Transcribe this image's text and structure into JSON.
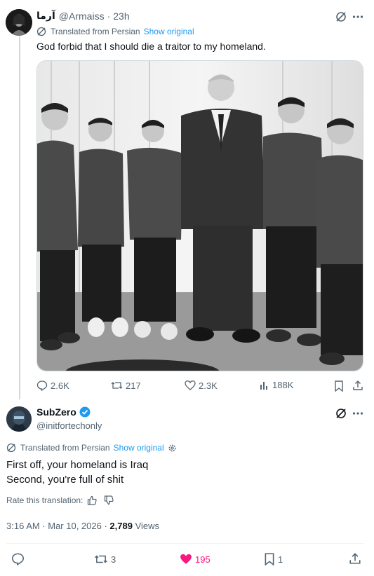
{
  "quoted": {
    "display_name": "آرما",
    "handle": "@Armaiss",
    "separator": "·",
    "time": "23h",
    "translated_label": "Translated from Persian",
    "show_original": "Show original",
    "text": "God forbid that I should die a traitor to my homeland.",
    "stats": {
      "replies": "2.6K",
      "reposts": "217",
      "likes": "2.3K",
      "views": "188K"
    }
  },
  "reply": {
    "display_name": "SubZero",
    "handle": "@initfortechonly",
    "translated_label": "Translated from Persian",
    "show_original": "Show original",
    "text_line1": "First off, your homeland is Iraq",
    "text_line2": "Second, you're full of shit",
    "rate_label": "Rate this translation:",
    "timestamp": "3:16 AM · Mar 10, 2026 · ",
    "views_count": "2,789",
    "views_label": " Views",
    "stats": {
      "reposts": "3",
      "likes": "195",
      "bookmarks": "1"
    }
  },
  "colors": {
    "accent": "#1d9bf0",
    "like": "#f91880",
    "muted": "#536471",
    "verified": "#1d9bf0"
  }
}
